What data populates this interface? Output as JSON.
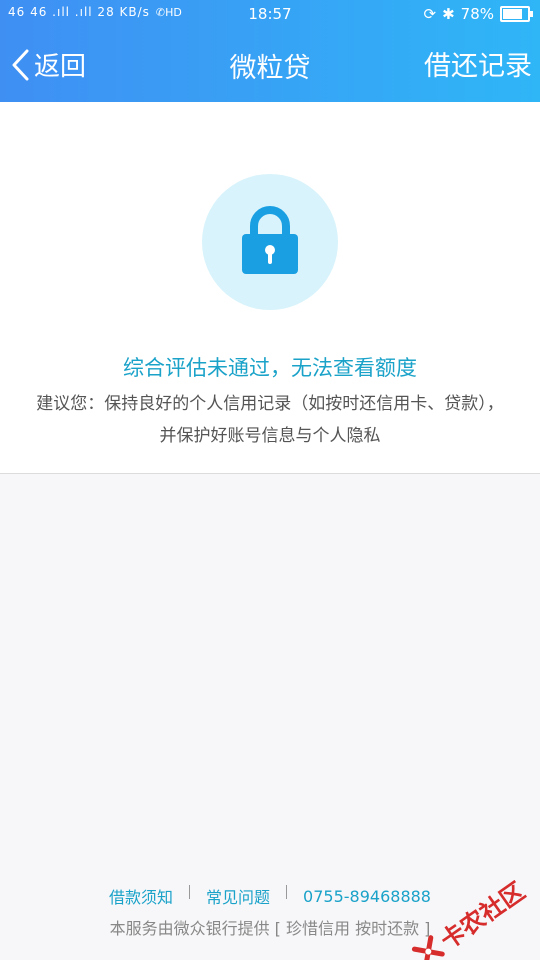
{
  "status_bar": {
    "left_text": "46 46 .ıll .ıll 28 KB/s",
    "hd": "HD",
    "time": "18:57",
    "battery_percent": "78%",
    "battery_level": 0.78
  },
  "nav": {
    "back_label": "返回",
    "title": "微粒贷",
    "right_label": "借还记录"
  },
  "main": {
    "headline": "综合评估未通过，无法查看额度",
    "advice": "建议您：保持良好的个人信用记录（如按时还信用卡、贷款），并保护好账号信息与个人隐私"
  },
  "footer": {
    "links": [
      "借款须知",
      "常见问题",
      "0755-89468888"
    ],
    "note": "本服务由微众银行提供 [ 珍惜信用 按时还款 ]"
  },
  "watermark": {
    "text": "卡农社区"
  },
  "colors": {
    "accent": "#1aa2c9",
    "header_start": "#3f8ff3",
    "header_end": "#2fb6f7",
    "lock_blue": "#1b9fe3",
    "lock_bg": "#d8f3fb"
  }
}
